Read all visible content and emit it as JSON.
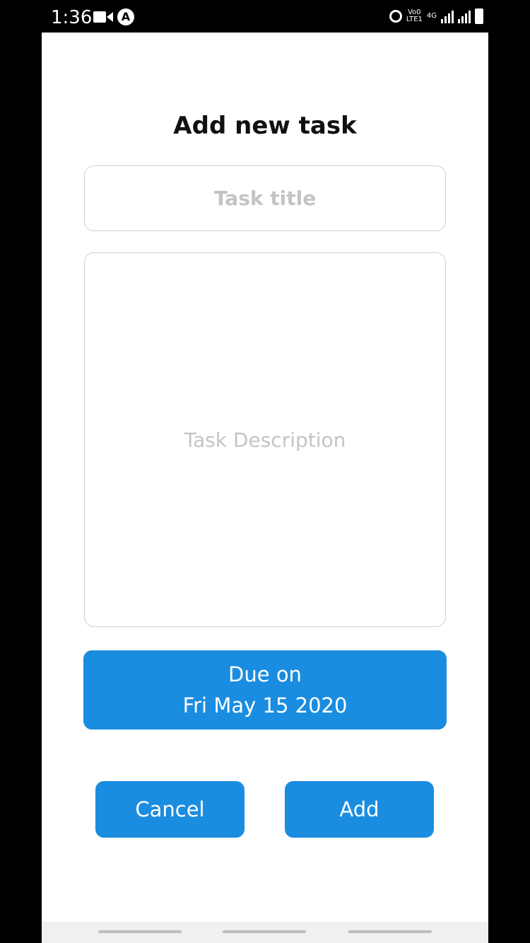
{
  "status_bar": {
    "time": "1:36",
    "network_top": "Vo0",
    "network_bottom": "LTE1",
    "gen_label": "4G",
    "icons": [
      "video-icon",
      "a-notification-icon",
      "alarm-icon",
      "signal-icon",
      "battery-icon"
    ]
  },
  "dialog": {
    "title": "Add new task",
    "task_title_placeholder": "Task title",
    "task_description_placeholder": "Task Description",
    "due_label": "Due on",
    "due_date": "Fri May 15 2020",
    "cancel_label": "Cancel",
    "add_label": "Add"
  },
  "colors": {
    "accent": "#1a8de0",
    "placeholder": "#c4c4c4",
    "border": "#cfcfcf"
  }
}
